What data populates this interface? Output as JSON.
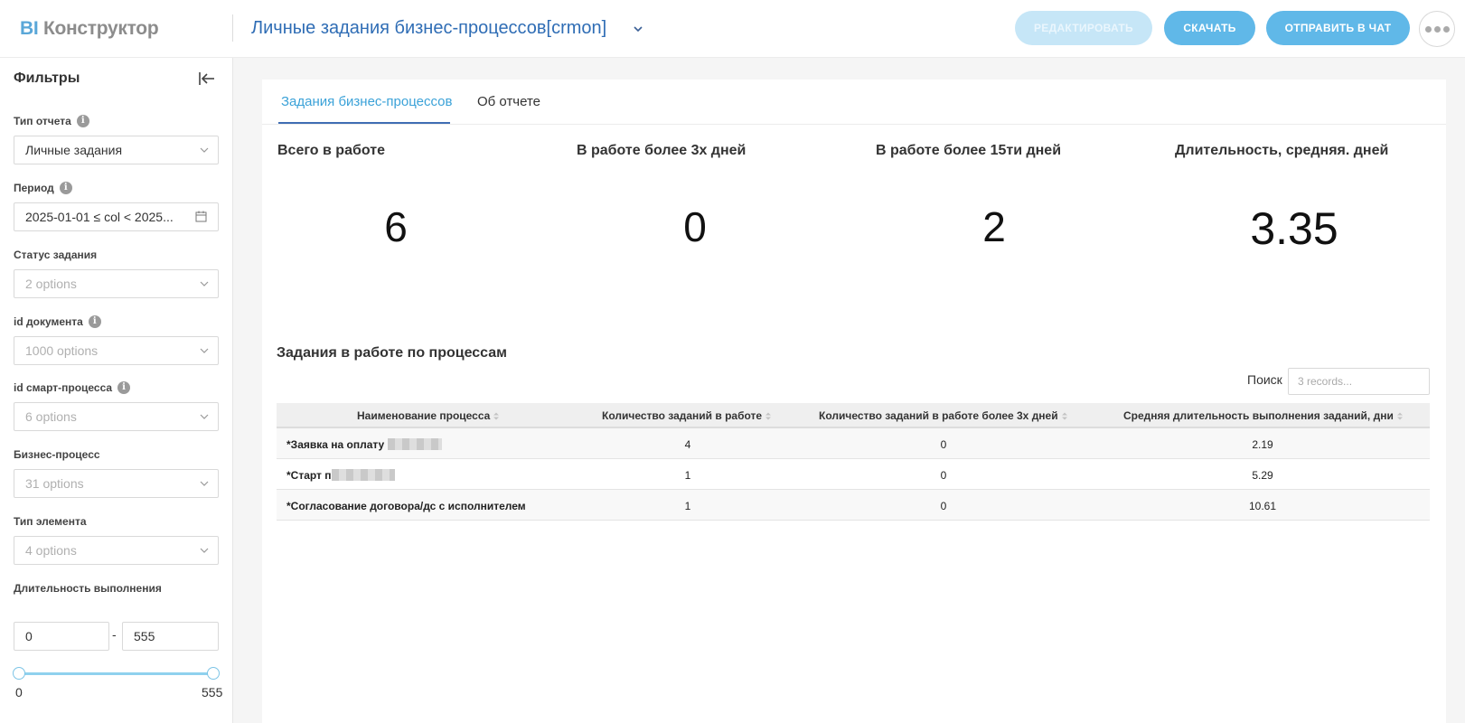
{
  "header": {
    "logo_prefix": "BI",
    "logo_text": "Конструктор",
    "dashboard_title": "Личные задания бизнес-процессов[crmon]",
    "buttons": {
      "edit": "РЕДАКТИРОВАТЬ",
      "download": "СКАЧАТЬ",
      "send_chat": "ОТПРАВИТЬ В ЧАТ"
    }
  },
  "sidebar": {
    "title": "Фильтры",
    "filters": {
      "report_type": {
        "label": "Тип отчета",
        "value": "Личные задания"
      },
      "period": {
        "label": "Период",
        "value": "2025-01-01 ≤ col < 2025..."
      },
      "task_status": {
        "label": "Статус задания",
        "placeholder": "2 options"
      },
      "document_id": {
        "label": "id документа",
        "placeholder": "1000 options"
      },
      "smart_process_id": {
        "label": "id смарт-процесса",
        "placeholder": "6 options"
      },
      "business_process": {
        "label": "Бизнес-процесс",
        "placeholder": "31 options"
      },
      "element_type": {
        "label": "Тип элемента",
        "placeholder": "4 options"
      },
      "duration": {
        "label": "Длительность выполнения",
        "min": "0",
        "max": "555",
        "separator": "-",
        "slider_min_label": "0",
        "slider_max_label": "555"
      }
    }
  },
  "main": {
    "tabs": [
      {
        "label": "Задания бизнес-процессов",
        "active": true
      },
      {
        "label": "Об отчете",
        "active": false
      }
    ],
    "metrics": [
      {
        "title": "Всего в работе",
        "value": "6"
      },
      {
        "title": "В работе более 3х дней",
        "value": "0"
      },
      {
        "title": "В работе более 15ти дней",
        "value": "2"
      },
      {
        "title": "Длительность, средняя. дней",
        "value": "3.35"
      }
    ],
    "table_section": {
      "title": "Задания в работе по процессам",
      "search_label": "Поиск",
      "search_placeholder": "3 records...",
      "columns": [
        "Наименование процесса",
        "Количество заданий в работе",
        "Количество заданий в работе более 3х дней",
        "Средняя длительность выполнения заданий, дни"
      ],
      "rows": [
        {
          "name": "*Заявка на оплату",
          "count": "4",
          "over3": "0",
          "avg": "2.19"
        },
        {
          "name": "*Старт п",
          "count": "1",
          "over3": "0",
          "avg": "5.29"
        },
        {
          "name": "*Согласование договора/дс с исполнителем",
          "count": "1",
          "over3": "0",
          "avg": "10.61"
        }
      ]
    }
  }
}
